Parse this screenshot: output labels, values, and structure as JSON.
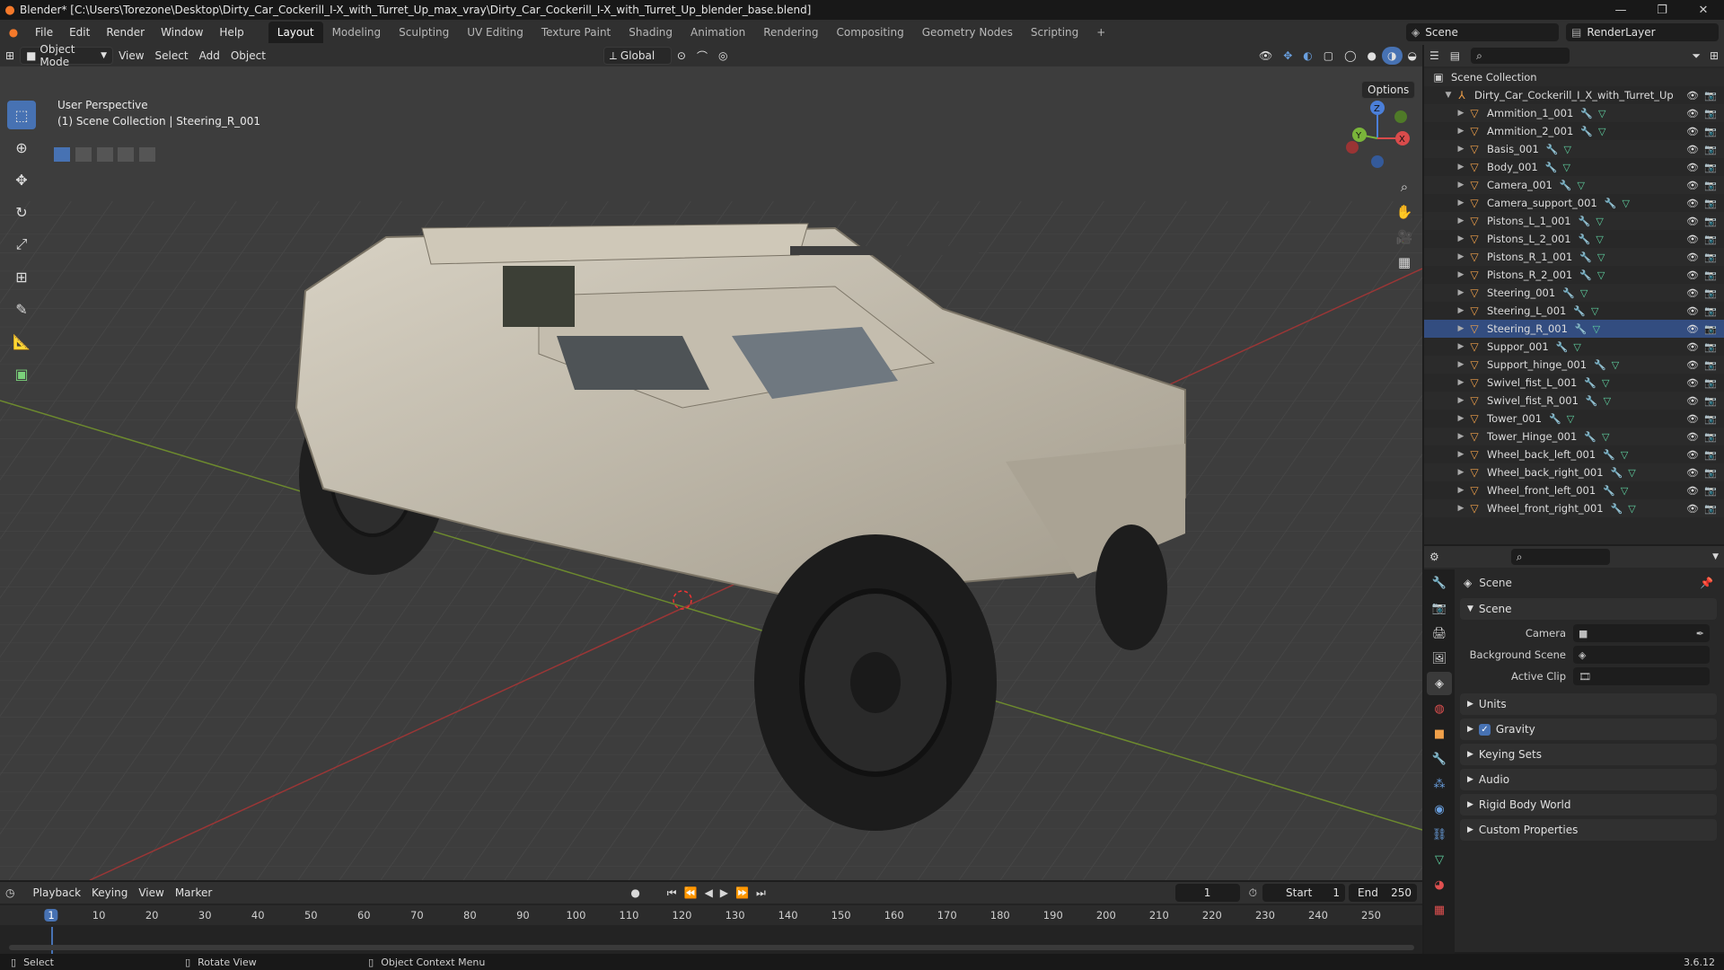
{
  "window": {
    "title": "Blender* [C:\\Users\\Torezone\\Desktop\\Dirty_Car_Cockerill_I-X_with_Turret_Up_max_vray\\Dirty_Car_Cockerill_I-X_with_Turret_Up_blender_base.blend]",
    "minimize": "—",
    "restore": "❐",
    "close": "✕"
  },
  "menus": [
    "File",
    "Edit",
    "Render",
    "Window",
    "Help"
  ],
  "workspaces": [
    "Layout",
    "Modeling",
    "Sculpting",
    "UV Editing",
    "Texture Paint",
    "Shading",
    "Animation",
    "Rendering",
    "Compositing",
    "Geometry Nodes",
    "Scripting"
  ],
  "workspace_add": "+",
  "scene_field": "Scene",
  "render_layer_field": "RenderLayer",
  "viewport_header": {
    "mode": "Object Mode",
    "menus": [
      "View",
      "Select",
      "Add",
      "Object"
    ],
    "transform": "Global",
    "options": "Options"
  },
  "viewport": {
    "perspective": "User Perspective",
    "collection": "(1) Scene Collection | Steering_R_001",
    "gizmo": {
      "x": "X",
      "y": "Y",
      "z": "Z"
    }
  },
  "outliner": {
    "root": "Scene Collection",
    "collection": "Dirty_Car_Cockerill_I_X_with_Turret_Up",
    "objects": [
      "Ammition_1_001",
      "Ammition_2_001",
      "Basis_001",
      "Body_001",
      "Camera_001",
      "Camera_support_001",
      "Pistons_L_1_001",
      "Pistons_L_2_001",
      "Pistons_R_1_001",
      "Pistons_R_2_001",
      "Steering_001",
      "Steering_L_001",
      "Steering_R_001",
      "Suppor_001",
      "Support_hinge_001",
      "Swivel_fist_L_001",
      "Swivel_fist_R_001",
      "Tower_001",
      "Tower_Hinge_001",
      "Wheel_back_left_001",
      "Wheel_back_right_001",
      "Wheel_front_left_001",
      "Wheel_front_right_001"
    ]
  },
  "properties": {
    "header": "Scene",
    "panel": "Scene",
    "fields": [
      {
        "label": "Camera"
      },
      {
        "label": "Background Scene"
      },
      {
        "label": "Active Clip"
      }
    ],
    "subpanels": [
      "Units",
      "Gravity",
      "Keying Sets",
      "Audio",
      "Rigid Body World",
      "Custom Properties"
    ]
  },
  "timeline": {
    "menus": [
      "Playback",
      "Keying",
      "View",
      "Marker"
    ],
    "current_frame": "1",
    "start_label": "Start",
    "start": "1",
    "end_label": "End",
    "end": "250",
    "ticks": [
      "1",
      "10",
      "20",
      "30",
      "40",
      "50",
      "60",
      "70",
      "80",
      "90",
      "100",
      "110",
      "120",
      "130",
      "140",
      "150",
      "160",
      "170",
      "180",
      "190",
      "200",
      "210",
      "220",
      "230",
      "240",
      "250"
    ]
  },
  "status": {
    "select": "Select",
    "rotate": "Rotate View",
    "context": "Object Context Menu",
    "version": "3.6.12"
  },
  "colors": {
    "accent": "#4772b3",
    "object": "#f0a04a",
    "mesh": "#5fd1a0",
    "vehicle": "#c9c2b3"
  }
}
